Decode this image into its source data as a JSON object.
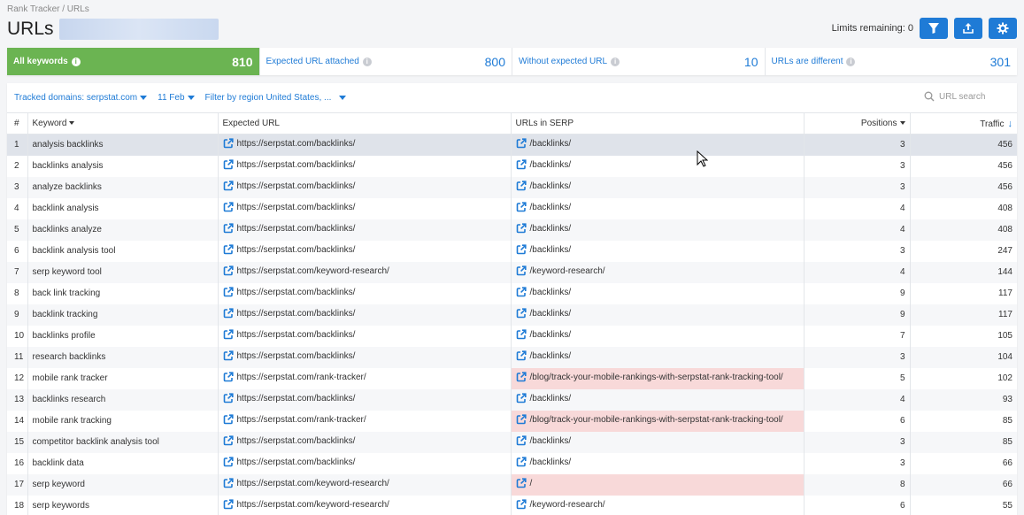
{
  "breadcrumb": "Rank Tracker / URLs",
  "page_title": "URLs",
  "limits_text": "Limits remaining: 0",
  "toolbar": {
    "filter_icon": "filter-icon",
    "export_icon": "export-icon",
    "settings_icon": "gear-icon"
  },
  "colors": {
    "accent": "#1f7bd6",
    "active_card": "#6bb452",
    "diff_row": "#f8d9d9"
  },
  "cards": [
    {
      "label": "All keywords",
      "value": "810"
    },
    {
      "label": "Expected URL attached",
      "value": "800"
    },
    {
      "label": "Without expected URL",
      "value": "10"
    },
    {
      "label": "URLs are different",
      "value": "301"
    }
  ],
  "filters": {
    "domains": "Tracked domains: serpstat.com",
    "date": "11 Feb",
    "region": "Filter by region United States, ...",
    "search_placeholder": "URL search"
  },
  "table": {
    "headers": {
      "num": "#",
      "keyword": "Keyword",
      "expected": "Expected URL",
      "serp": "URLs in SERP",
      "positions": "Positions",
      "traffic": "Traffic"
    },
    "rows": [
      {
        "n": "1",
        "kw": "analysis backlinks",
        "exp": "https://serpstat.com/backlinks/",
        "serp": "/backlinks/",
        "pos": "3",
        "traffic": "456"
      },
      {
        "n": "2",
        "kw": "backlinks analysis",
        "exp": "https://serpstat.com/backlinks/",
        "serp": "/backlinks/",
        "pos": "3",
        "traffic": "456"
      },
      {
        "n": "3",
        "kw": "analyze backlinks",
        "exp": "https://serpstat.com/backlinks/",
        "serp": "/backlinks/",
        "pos": "3",
        "traffic": "456"
      },
      {
        "n": "4",
        "kw": "backlink analysis",
        "exp": "https://serpstat.com/backlinks/",
        "serp": "/backlinks/",
        "pos": "4",
        "traffic": "408"
      },
      {
        "n": "5",
        "kw": "backlinks analyze",
        "exp": "https://serpstat.com/backlinks/",
        "serp": "/backlinks/",
        "pos": "4",
        "traffic": "408"
      },
      {
        "n": "6",
        "kw": "backlink analysis tool",
        "exp": "https://serpstat.com/backlinks/",
        "serp": "/backlinks/",
        "pos": "3",
        "traffic": "247"
      },
      {
        "n": "7",
        "kw": "serp keyword tool",
        "exp": "https://serpstat.com/keyword-research/",
        "serp": "/keyword-research/",
        "pos": "4",
        "traffic": "144"
      },
      {
        "n": "8",
        "kw": "back link tracking",
        "exp": "https://serpstat.com/backlinks/",
        "serp": "/backlinks/",
        "pos": "9",
        "traffic": "117"
      },
      {
        "n": "9",
        "kw": "backlink tracking",
        "exp": "https://serpstat.com/backlinks/",
        "serp": "/backlinks/",
        "pos": "9",
        "traffic": "117"
      },
      {
        "n": "10",
        "kw": "backlinks profile",
        "exp": "https://serpstat.com/backlinks/",
        "serp": "/backlinks/",
        "pos": "7",
        "traffic": "105"
      },
      {
        "n": "11",
        "kw": "research backlinks",
        "exp": "https://serpstat.com/backlinks/",
        "serp": "/backlinks/",
        "pos": "3",
        "traffic": "104"
      },
      {
        "n": "12",
        "kw": "mobile rank tracker",
        "exp": "https://serpstat.com/rank-tracker/",
        "serp": "/blog/track-your-mobile-rankings-with-serpstat-rank-tracking-tool/",
        "pos": "5",
        "traffic": "102",
        "diff": true
      },
      {
        "n": "13",
        "kw": "backlinks research",
        "exp": "https://serpstat.com/backlinks/",
        "serp": "/backlinks/",
        "pos": "4",
        "traffic": "93"
      },
      {
        "n": "14",
        "kw": "mobile rank tracking",
        "exp": "https://serpstat.com/rank-tracker/",
        "serp": "/blog/track-your-mobile-rankings-with-serpstat-rank-tracking-tool/",
        "pos": "6",
        "traffic": "85",
        "diff": true
      },
      {
        "n": "15",
        "kw": "competitor backlink analysis tool",
        "exp": "https://serpstat.com/backlinks/",
        "serp": "/backlinks/",
        "pos": "3",
        "traffic": "85"
      },
      {
        "n": "16",
        "kw": "backlink data",
        "exp": "https://serpstat.com/backlinks/",
        "serp": "/backlinks/",
        "pos": "3",
        "traffic": "66"
      },
      {
        "n": "17",
        "kw": "serp keyword",
        "exp": "https://serpstat.com/keyword-research/",
        "serp": "/",
        "pos": "8",
        "traffic": "66",
        "diff": true
      },
      {
        "n": "18",
        "kw": "serp keywords",
        "exp": "https://serpstat.com/keyword-research/",
        "serp": "/keyword-research/",
        "pos": "6",
        "traffic": "55"
      }
    ]
  }
}
